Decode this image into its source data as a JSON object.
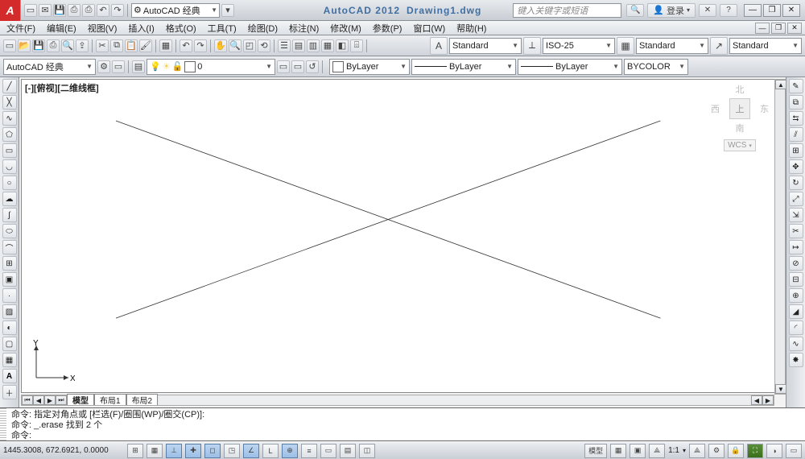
{
  "app": {
    "logo_letter": "A",
    "product": "AutoCAD 2012",
    "document": "Drawing1.dwg",
    "search_placeholder": "键入关键字或短语",
    "signin_label": "登录"
  },
  "workspace": {
    "drop_label": "AutoCAD 经典",
    "drop_label2": "AutoCAD 经典"
  },
  "menu": {
    "items": [
      "文件(F)",
      "编辑(E)",
      "视图(V)",
      "插入(I)",
      "格式(O)",
      "工具(T)",
      "绘图(D)",
      "标注(N)",
      "修改(M)",
      "参数(P)",
      "窗口(W)",
      "帮助(H)"
    ]
  },
  "toolbar2": {
    "text_style": "Standard",
    "dim_style": "ISO-25",
    "table_style": "Standard",
    "mleader_style": "Standard"
  },
  "toolbar3": {
    "layer_combo": "0",
    "color_label": "ByLayer",
    "linetype_label": "ByLayer",
    "lineweight_label": "ByLayer",
    "plotstyle_label": "BYCOLOR"
  },
  "canvas": {
    "view_label": "[-][俯视][二维线框]"
  },
  "viewcube": {
    "north": "北",
    "south": "南",
    "east": "东",
    "west": "西",
    "top": "上",
    "wcs": "WCS"
  },
  "ucs": {
    "x": "X",
    "y": "Y"
  },
  "tabs": {
    "model": "模型",
    "layout1": "布局1",
    "layout2": "布局2"
  },
  "command": {
    "line1": "命令: 指定对角点或 [栏选(F)/圈围(WP)/圈交(CP)]:",
    "line2": "命令: _.erase 找到 2 个",
    "prompt": "命令:"
  },
  "status": {
    "coords": "1445.3008, 672.6921, 0.0000",
    "scale": "1:1",
    "model_btn": "模型"
  }
}
